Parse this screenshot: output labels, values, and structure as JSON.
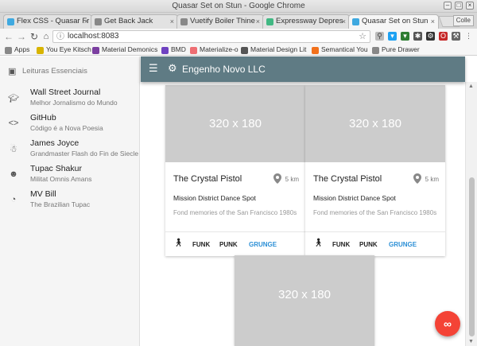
{
  "window": {
    "title": "Quasar Set on Stun - Google Chrome"
  },
  "tabs": [
    {
      "label": "Flex CSS - Quasar Fr",
      "color": "#3fa9e0"
    },
    {
      "label": "Get Back Jack",
      "color": "#888888"
    },
    {
      "label": "Vuetify Boiler Thine",
      "color": "#888888"
    },
    {
      "label": "Expressway Depres",
      "color": "#41b883"
    },
    {
      "label": "Quasar Set on Stun",
      "color": "#3fa9e0",
      "active": true
    }
  ],
  "profile": "Colle",
  "address": {
    "url": "localhost:8083"
  },
  "bookmarks": [
    {
      "label": "Apps",
      "color": "#888888"
    },
    {
      "label": "You Eye Kitsch",
      "color": "#d8b400"
    },
    {
      "label": "Material Demonics",
      "color": "#7b3fa0"
    },
    {
      "label": "BMD",
      "color": "#6f42c1"
    },
    {
      "label": "Materialize-o",
      "color": "#ee6e73"
    },
    {
      "label": "Material Design Lit",
      "color": "#555555"
    },
    {
      "label": "Semantical You",
      "color": "#f2711c"
    },
    {
      "label": "Pure Drawer",
      "color": "#888888"
    }
  ],
  "sidebar": {
    "header": "Leituras Essenciais",
    "items": [
      {
        "title": "Wall Street Journal",
        "subtitle": "Melhor Jornalismo do Mundo",
        "icon": "school-icon"
      },
      {
        "title": "GitHub",
        "subtitle": "Código é a Nova Poesia",
        "icon": "code-icon"
      },
      {
        "title": "James Joyce",
        "subtitle": "Grandmaster Flash do Fin de Siecle",
        "icon": "accessibility-icon"
      },
      {
        "title": "Tupac Shakur",
        "subtitle": "Militat Omnis Amans",
        "icon": "record-voice-icon"
      },
      {
        "title": "MV Bill",
        "subtitle": "The Brazilian Tupac",
        "icon": "rss-feed-icon"
      }
    ]
  },
  "header": {
    "title": "Engenho Novo LLC"
  },
  "cards": [
    {
      "image": "320 x 180",
      "title": "The Crystal Pistol",
      "distance": "5 km",
      "subtitle": "Mission District Dance Spot",
      "description": "Fond memories of the San Francisco 1980s",
      "actions": [
        "FUNK",
        "PUNK",
        "GRUNGE"
      ]
    },
    {
      "image": "320 x 180",
      "title": "The Crystal Pistol",
      "distance": "5 km",
      "subtitle": "Mission District Dance Spot",
      "description": "Fond memories of the San Francisco 1980s",
      "actions": [
        "FUNK",
        "PUNK",
        "GRUNGE"
      ]
    },
    {
      "image": "320 x 180"
    }
  ],
  "colors": {
    "header": "#5f7b84",
    "fab": "#f44336",
    "accent_link": "#2b8fd6",
    "placeholder": "#cccccc"
  },
  "fab": {
    "icon": "infinity-icon"
  }
}
